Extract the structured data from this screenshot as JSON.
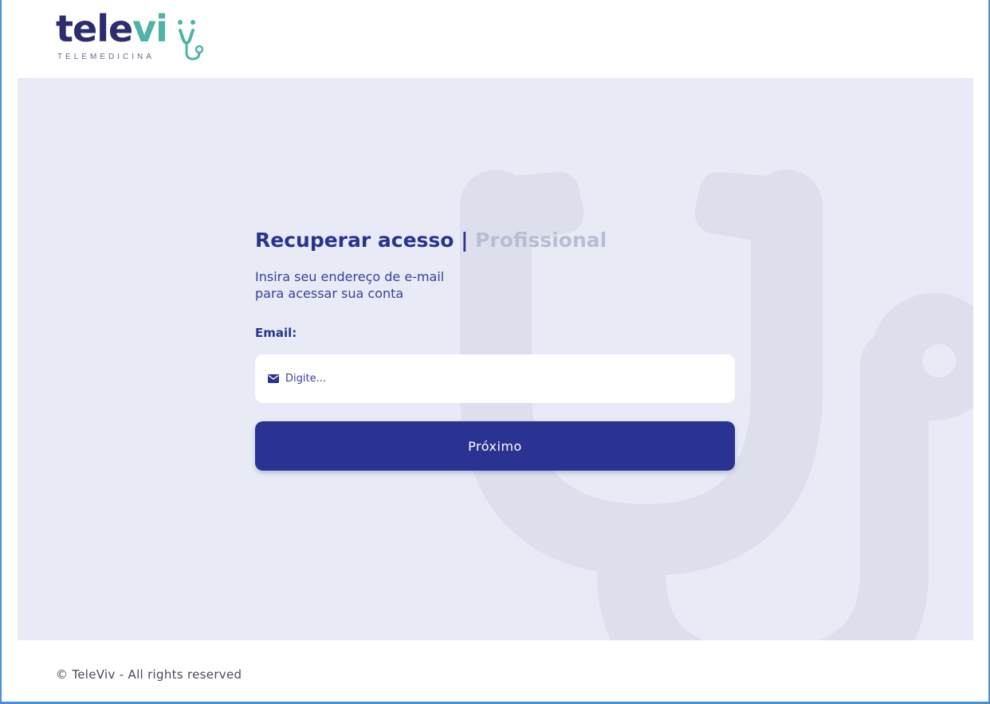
{
  "brand": {
    "name_part1": "tele",
    "name_part2": "vi",
    "tagline": "TELEMEDICINA",
    "primary_color": "#2d2c6e",
    "accent_color": "#4fb3a5"
  },
  "form": {
    "title": "Recuperar acesso",
    "separator": "|",
    "role": "Profissional",
    "subtitle_line1": "Insira seu endereço de e-mail",
    "subtitle_line2": "para acessar sua conta",
    "email_label": "Email:",
    "email_placeholder": "Digite...",
    "email_value": "",
    "email_icon": "envelope-icon",
    "next_label": "Próximo",
    "button_color": "#2b3392"
  },
  "footer": {
    "copyright": "© TeleViv - All rights reserved"
  },
  "theme": {
    "background": "#e8ebf5",
    "watermark_icon": "stethoscope-icon"
  }
}
